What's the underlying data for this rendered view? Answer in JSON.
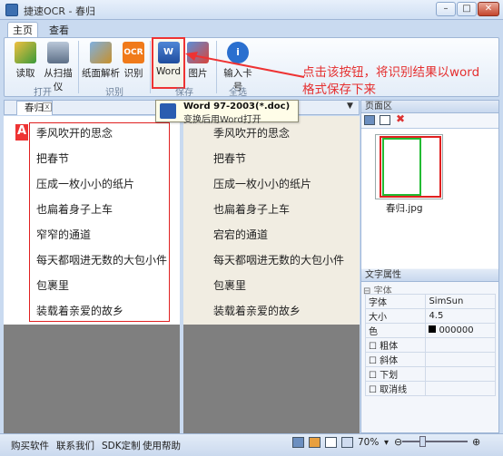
{
  "window": {
    "title": "捷速OCR - 春归",
    "min": "–",
    "max": "□",
    "close": "✕"
  },
  "tabs": [
    "主页",
    "查看"
  ],
  "ribbon": {
    "groups": [
      {
        "label": "打开",
        "buttons": [
          "读取",
          "从扫描仪"
        ]
      },
      {
        "label": "识别",
        "buttons": [
          "纸面解析",
          "识别"
        ]
      },
      {
        "label": "保存",
        "buttons": [
          "Word",
          "图片"
        ]
      },
      {
        "label": "全选",
        "buttons": [
          "输入卡号"
        ]
      }
    ]
  },
  "annotation": [
    "点击该按钮，将识别结果以word",
    "格式保存下来"
  ],
  "tooltip": {
    "title": "Word 97-2003(*.doc)",
    "desc": "变换后用Word打开"
  },
  "doc_tab": {
    "label": "春归",
    "close": "x"
  },
  "lines": [
    "季风吹开的思念",
    "把春节",
    "压成一枚小小的纸片",
    "也扁着身子上车",
    "窄窄的通道",
    "每天都咽进无数的大包小件",
    "包裹里",
    "装载着亲爱的故乡"
  ],
  "ocr_lines": [
    "季风吹开的思念",
    "把春节",
    "压成一枚小小的纸片",
    "也扁着身子上车",
    "宕宕的通道",
    "每天都咽进无数的大包小件",
    "包裹里",
    "装载着亲爱的故乡"
  ],
  "sidebar": {
    "pages_header": "页面区",
    "thumb_label": "春归.jpg",
    "props_header": "文字属性",
    "props_section": "字体",
    "props": [
      {
        "name": "字体",
        "value": "SimSun"
      },
      {
        "name": "大小",
        "value": "4.5"
      },
      {
        "name": "色",
        "value": "000000"
      }
    ],
    "checkboxes": [
      "粗体",
      "斜体",
      "下划",
      "取消线"
    ]
  },
  "status": {
    "links": [
      "购买软件",
      "联系我们",
      "SDK定制",
      "使用帮助"
    ],
    "zoom": "70%"
  }
}
